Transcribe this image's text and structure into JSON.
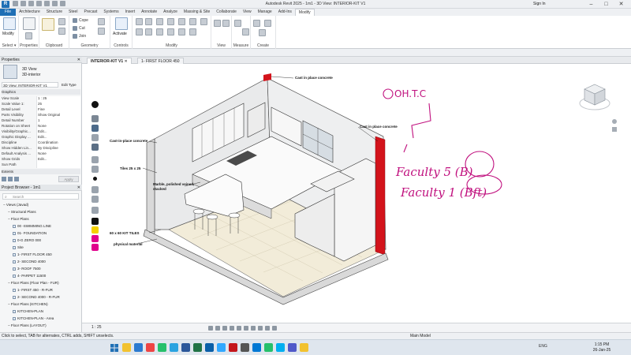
{
  "titlebar": {
    "title": "Autodesk Revit 2025 - 1m1 - 3D View: INTERIOR-KIT V1",
    "signin": "Sign In",
    "icons": [
      "revit-logo",
      "open-icon",
      "save-icon",
      "undo-icon",
      "redo-icon",
      "print-icon"
    ]
  },
  "ribbon": {
    "file_label": "File",
    "tabs": [
      "Architecture",
      "Structure",
      "Steel",
      "Precast",
      "Systems",
      "Insert",
      "Annotate",
      "Analyze",
      "Massing & Site",
      "Collaborate",
      "View",
      "Manage",
      "Add-Ins",
      "Modify"
    ],
    "active_tab": "Modify",
    "groups": {
      "select": "Select",
      "properties": "Properties",
      "clipboard": "Clipboard",
      "geometry": "Geometry",
      "controls": "Controls",
      "modify": "Modify",
      "view": "View",
      "measure": "Measure",
      "create": "Create"
    },
    "buttons": {
      "modify": "Modify",
      "cope": "Cope",
      "cut": "Cut",
      "join": "Join",
      "activate": "Activate"
    },
    "select_dropdown": "Select ▾"
  },
  "properties": {
    "header": "Properties",
    "type_name": "3D View",
    "type_sub": "3D-interior",
    "selector_value": "3D View: INTERIOR-KIT V1",
    "edit_type": "Edit Type",
    "section_graphics": "Graphics",
    "rows": [
      {
        "k": "View Scale",
        "v": "1 : 25"
      },
      {
        "k": "Scale Value   1:",
        "v": "25"
      },
      {
        "k": "Detail Level",
        "v": "Fine"
      },
      {
        "k": "Parts Visibility",
        "v": "Show Original"
      },
      {
        "k": "Detail Number",
        "v": "1"
      },
      {
        "k": "Rotation on Sheet",
        "v": "None"
      },
      {
        "k": "Visibility/Graphic...",
        "v": "Edit..."
      },
      {
        "k": "Graphic Display ...",
        "v": "Edit..."
      },
      {
        "k": "Discipline",
        "v": "Coordination"
      },
      {
        "k": "Show Hidden Lin...",
        "v": "By Discipline"
      },
      {
        "k": "Default Analysis ...",
        "v": "None"
      },
      {
        "k": "Show Grids",
        "v": "Edit..."
      },
      {
        "k": "Sun Path",
        "v": ""
      }
    ],
    "section_extents": "Extents",
    "apply": "Apply"
  },
  "browser": {
    "header": "Project Browser - 1m1",
    "search_placeholder": "Search",
    "items": [
      {
        "label": "Views (Javad)",
        "level": 0
      },
      {
        "label": "Structural Plans",
        "level": 1
      },
      {
        "label": "Floor Plans",
        "level": 1
      },
      {
        "label": "00 -SWIMMING LINE",
        "level": 2
      },
      {
        "label": "01- FOUNDATION",
        "level": 2
      },
      {
        "label": "0-G ZERO 000",
        "level": 2
      },
      {
        "label": "Site",
        "level": 2
      },
      {
        "label": "1- FIRST FLOOR 450",
        "level": 2
      },
      {
        "label": "2- SECOND 4000",
        "level": 2
      },
      {
        "label": "3- ROOF 7500",
        "level": 2
      },
      {
        "label": "4- PARPET 11500",
        "level": 2
      },
      {
        "label": "Floor Plans (Floor Plan - FUR)",
        "level": 1
      },
      {
        "label": "1- FIRST 450 - R-FUR",
        "level": 2
      },
      {
        "label": "2- SECOND 4000 - R-FUR",
        "level": 2
      },
      {
        "label": "Floor Plans (KITCHEN)",
        "level": 1
      },
      {
        "label": "KITCHEN-PLAN",
        "level": 2
      },
      {
        "label": "KITCHEN-PLAN - Area",
        "level": 2
      },
      {
        "label": "Floor Plans (LAYOUT)",
        "level": 1
      }
    ]
  },
  "viewtabs": [
    {
      "label": "INTERIOR-KIT V1",
      "active": true
    },
    {
      "label": "1- FIRST FLOOR 450",
      "active": false
    }
  ],
  "canvas": {
    "annotations": {
      "cip1": "Cast in place concrete",
      "cip2": "Cast in place concrete",
      "cip3": "Cast-in-place concrete",
      "tiles_wall": "Tiles 25 x 25",
      "marble": "Marble, polished veined, stacked",
      "kit_tiles": "60 x 60  KIT TILES",
      "physical": "physical material"
    },
    "handwriting": {
      "line1": "OH.T.C",
      "line2": "Faculty 5 (B)",
      "line3": "Faculty 1 (Bft)"
    }
  },
  "viewcontrol": {
    "scale": "1 : 25"
  },
  "statusbar": {
    "hint": "Click to select, TAB for alternates, CTRL adds, SHIFT unselects.",
    "main_model": "Main Model"
  },
  "taskbar": {
    "lang": "ENG",
    "time": "1:15 PM",
    "date": "26-Jan-25",
    "apps": [
      "chrome",
      "edge",
      "explorer",
      "whatsapp",
      "telegram",
      "word",
      "excel",
      "revit",
      "photoshop",
      "autocad",
      "settings",
      "store",
      "whatsapp2",
      "skype",
      "teams",
      "files"
    ]
  },
  "colors": {
    "accent": "#1f6fb5",
    "annotation_pen": "#c0107e",
    "concrete_red": "#d3131b"
  }
}
